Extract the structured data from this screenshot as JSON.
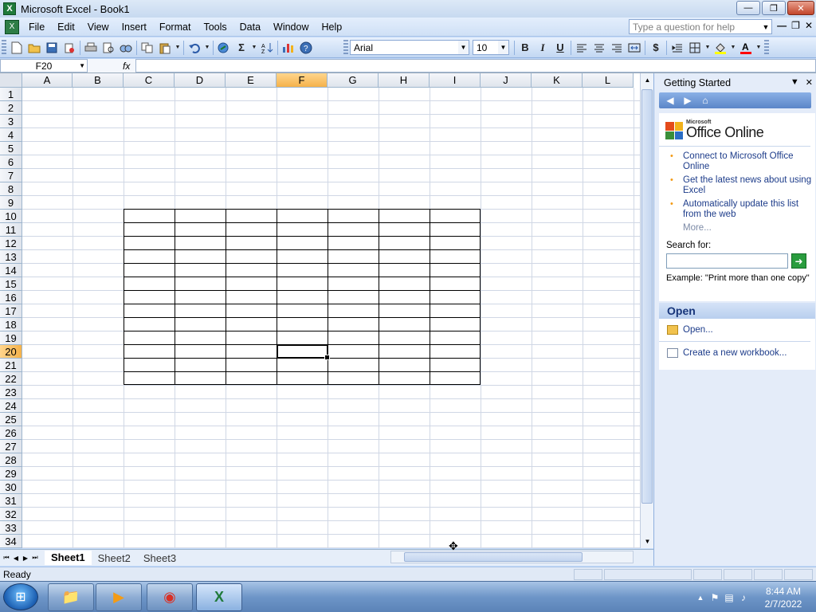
{
  "window": {
    "title": "Microsoft Excel - Book1",
    "app_icon": "X",
    "buttons": {
      "minimize": "—",
      "restore": "❐",
      "close": "✕"
    }
  },
  "menubar": {
    "items": [
      "File",
      "Edit",
      "View",
      "Insert",
      "Format",
      "Tools",
      "Data",
      "Window",
      "Help"
    ],
    "help_placeholder": "Type a question for help",
    "dropdown": "▼",
    "right_minimize": "—",
    "right_restore": "❐",
    "right_close": "✕"
  },
  "toolbar": {
    "font_name": "Arial",
    "font_size": "10",
    "bold": "B",
    "italic": "I",
    "underline": "U",
    "currency": "$",
    "dropdown": "▼"
  },
  "formula_bar": {
    "name_box": "F20",
    "name_box_dropdown": "▼",
    "fx_label": "fx",
    "formula": ""
  },
  "grid": {
    "columns": [
      "A",
      "B",
      "C",
      "D",
      "E",
      "F",
      "G",
      "H",
      "I",
      "J",
      "K",
      "L"
    ],
    "rows": [
      "1",
      "2",
      "3",
      "4",
      "5",
      "6",
      "7",
      "8",
      "9",
      "10",
      "11",
      "12",
      "13",
      "14",
      "15",
      "16",
      "17",
      "18",
      "19",
      "20",
      "21",
      "22",
      "23",
      "24",
      "25",
      "26",
      "27",
      "28",
      "29",
      "30",
      "31",
      "32",
      "33",
      "34"
    ],
    "selected_column": "F",
    "selected_row": "20",
    "selected_cell": "F20"
  },
  "sheet_tabs": {
    "tabs": [
      "Sheet1",
      "Sheet2",
      "Sheet3"
    ],
    "active": "Sheet1",
    "nav": [
      "⏮",
      "◀",
      "▶",
      "⏭"
    ]
  },
  "statusbar": {
    "status": "Ready"
  },
  "taskpane": {
    "title": "Getting Started",
    "dropdown": "▼",
    "close": "✕",
    "nav": {
      "back": "◀",
      "forward": "▶",
      "home": "⌂"
    },
    "logo_microsoft": "Microsoft",
    "logo_office_online": "Office Online",
    "links": [
      "Connect to Microsoft Office Online",
      "Get the latest news about using Excel",
      "Automatically update this list from the web"
    ],
    "bullet": "•",
    "more": "More...",
    "search_label": "Search for:",
    "search_go": "➜",
    "example": "Example:  \"Print more than one copy\"",
    "open_header": "Open",
    "open_link": "Open...",
    "new_workbook_link": "Create a new workbook..."
  },
  "taskbar": {
    "start": "⊞",
    "apps": [
      {
        "name": "explorer",
        "glyph": "📁"
      },
      {
        "name": "media-player",
        "glyph": "▶"
      },
      {
        "name": "chrome",
        "glyph": "◉"
      },
      {
        "name": "excel",
        "glyph": "X"
      }
    ],
    "time": "8:44 AM",
    "date": "2/7/2022",
    "tray_show_hidden": "▲",
    "tray_flag": "⚑",
    "tray_network": "▤",
    "tray_volume": "♪"
  }
}
